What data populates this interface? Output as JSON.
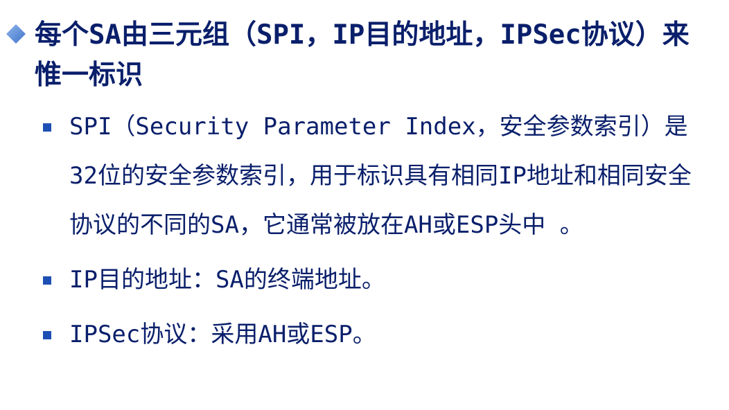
{
  "heading": {
    "text": "每个SA由三元组（SPI，IP目的地址，IPSec协议）来惟一标识",
    "bullet_icon": "diamond-icon",
    "bullet_color": "#5b8fd8"
  },
  "bullets": {
    "icon": "square-icon",
    "color": "#1e4fb4",
    "items": [
      {
        "text": "SPI（Security Parameter Index，安全参数索引）是32位的安全参数索引，用于标识具有相同IP地址和相同安全协议的不同的SA，它通常被放在AH或ESP头中 。"
      },
      {
        "text": "IP目的地址：SA的终端地址。"
      },
      {
        "text": "IPSec协议：采用AH或ESP。"
      }
    ]
  },
  "colors": {
    "text": "#0a1f6b",
    "background": "#ffffff"
  }
}
